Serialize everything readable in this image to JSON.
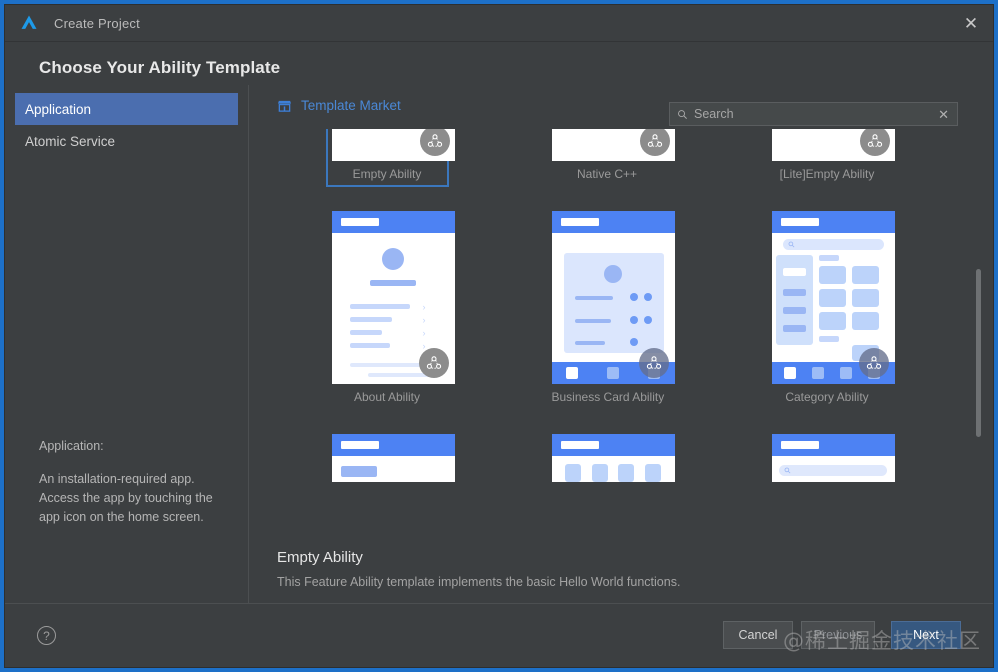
{
  "window": {
    "title": "Create Project",
    "logo_icon": "deveco-logo-icon",
    "close_icon": "close-icon",
    "accent": "#3b77bd",
    "bg": "#3c3f41"
  },
  "heading": "Choose Your Ability Template",
  "sidebar": {
    "items": [
      {
        "label": "Application",
        "selected": true
      },
      {
        "label": "Atomic Service",
        "selected": false
      }
    ],
    "description": {
      "title": "Application:",
      "body": "An installation-required app. Access the app by touching the app icon on the home screen."
    }
  },
  "market": {
    "icon": "store-icon",
    "label": "Template Market"
  },
  "search": {
    "icon": "search-icon",
    "placeholder": "Search",
    "value": "",
    "clear_icon": "close-icon"
  },
  "templates": {
    "rows": [
      [
        {
          "name": "Empty Ability",
          "selected": true
        },
        {
          "name": "Native C++",
          "selected": false
        },
        {
          "name": "[Lite]Empty Ability",
          "selected": false
        }
      ],
      [
        {
          "name": "About Ability",
          "selected": false
        },
        {
          "name": "Business Card Ability",
          "selected": false
        },
        {
          "name": "Category Ability",
          "selected": false
        }
      ],
      [
        {
          "name": "",
          "selected": false
        },
        {
          "name": "",
          "selected": false
        },
        {
          "name": "",
          "selected": false
        }
      ]
    ]
  },
  "detail": {
    "title": "Empty Ability",
    "description": "This Feature Ability template implements the basic Hello World functions."
  },
  "footer": {
    "help_icon": "help-icon",
    "cancel": "Cancel",
    "previous": "Previous",
    "next": "Next"
  },
  "watermark": "@稀土掘金技术社区"
}
